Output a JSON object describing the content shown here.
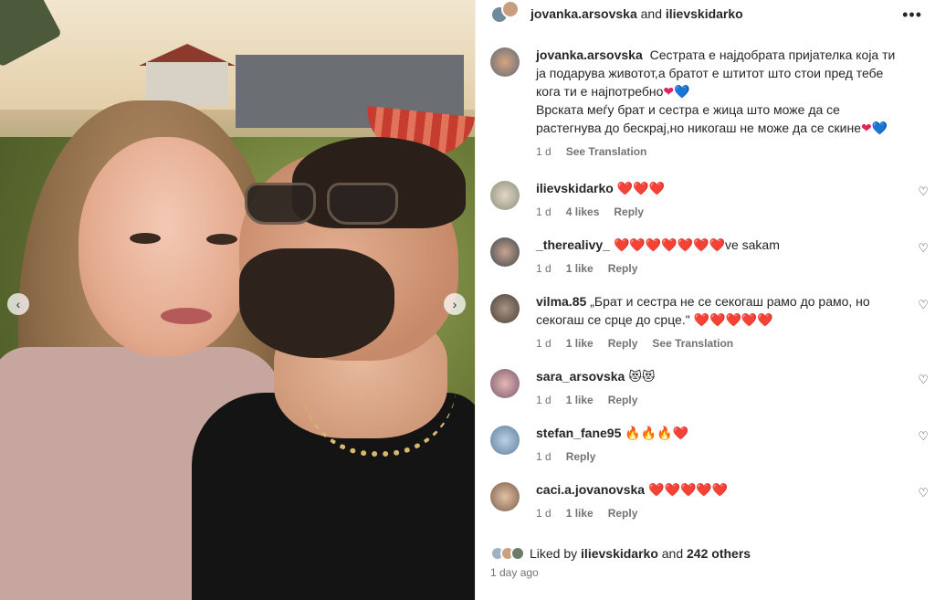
{
  "header": {
    "user1": "jovanka.arsovska",
    "and": "and",
    "user2": "ilievskidarko"
  },
  "post_caption": {
    "username": "jovanka.arsovska",
    "line1": "Сестрата е најдобрата пријателка која ти ја подарува животот,а братот е штитот што стои пред тебе кога ти е најпотребно",
    "line2": "Врската меѓу брат и сестра е жица што може да се растегнува до бескрај,но никогаш не може да се скине",
    "time": "1 d",
    "translate": "See Translation"
  },
  "comments": [
    {
      "username": "ilievskidarko",
      "text": "❤️❤️❤️",
      "time": "1 d",
      "likes": "4 likes",
      "reply": "Reply",
      "translate": ""
    },
    {
      "username": "_therealivy_",
      "text": "❤️❤️❤️❤️❤️❤️❤️ve sakam",
      "time": "1 d",
      "likes": "1 like",
      "reply": "Reply",
      "translate": ""
    },
    {
      "username": "vilma.85",
      "text": "„Брат и сестра не се секогаш рамо до рамо, но секогаш се срце до срце.\" ❤️❤️❤️❤️❤️",
      "time": "1 d",
      "likes": "1 like",
      "reply": "Reply",
      "translate": "See Translation"
    },
    {
      "username": "sara_arsovska",
      "text": "😻😻",
      "time": "1 d",
      "likes": "1 like",
      "reply": "Reply",
      "translate": ""
    },
    {
      "username": "stefan_fane95",
      "text": "🔥🔥🔥❤️",
      "time": "1 d",
      "likes": "",
      "reply": "Reply",
      "translate": ""
    },
    {
      "username": "caci.a.jovanovska",
      "text": "❤️❤️❤️❤️❤️",
      "time": "1 d",
      "likes": "1 like",
      "reply": "Reply",
      "translate": ""
    }
  ],
  "liked_by": {
    "prefix": "Liked by",
    "user": "ilievskidarko",
    "and": "and",
    "others": "242 others"
  },
  "posted": "1 day ago",
  "icons": {
    "more": "more-options-icon",
    "like": "heart-outline-icon",
    "prev": "chevron-left-icon",
    "next": "chevron-right-icon"
  },
  "colors": {
    "text": "#262626",
    "secondary": "#737373",
    "heart": "#e0245e",
    "blue_heart": "#2b7de9"
  }
}
